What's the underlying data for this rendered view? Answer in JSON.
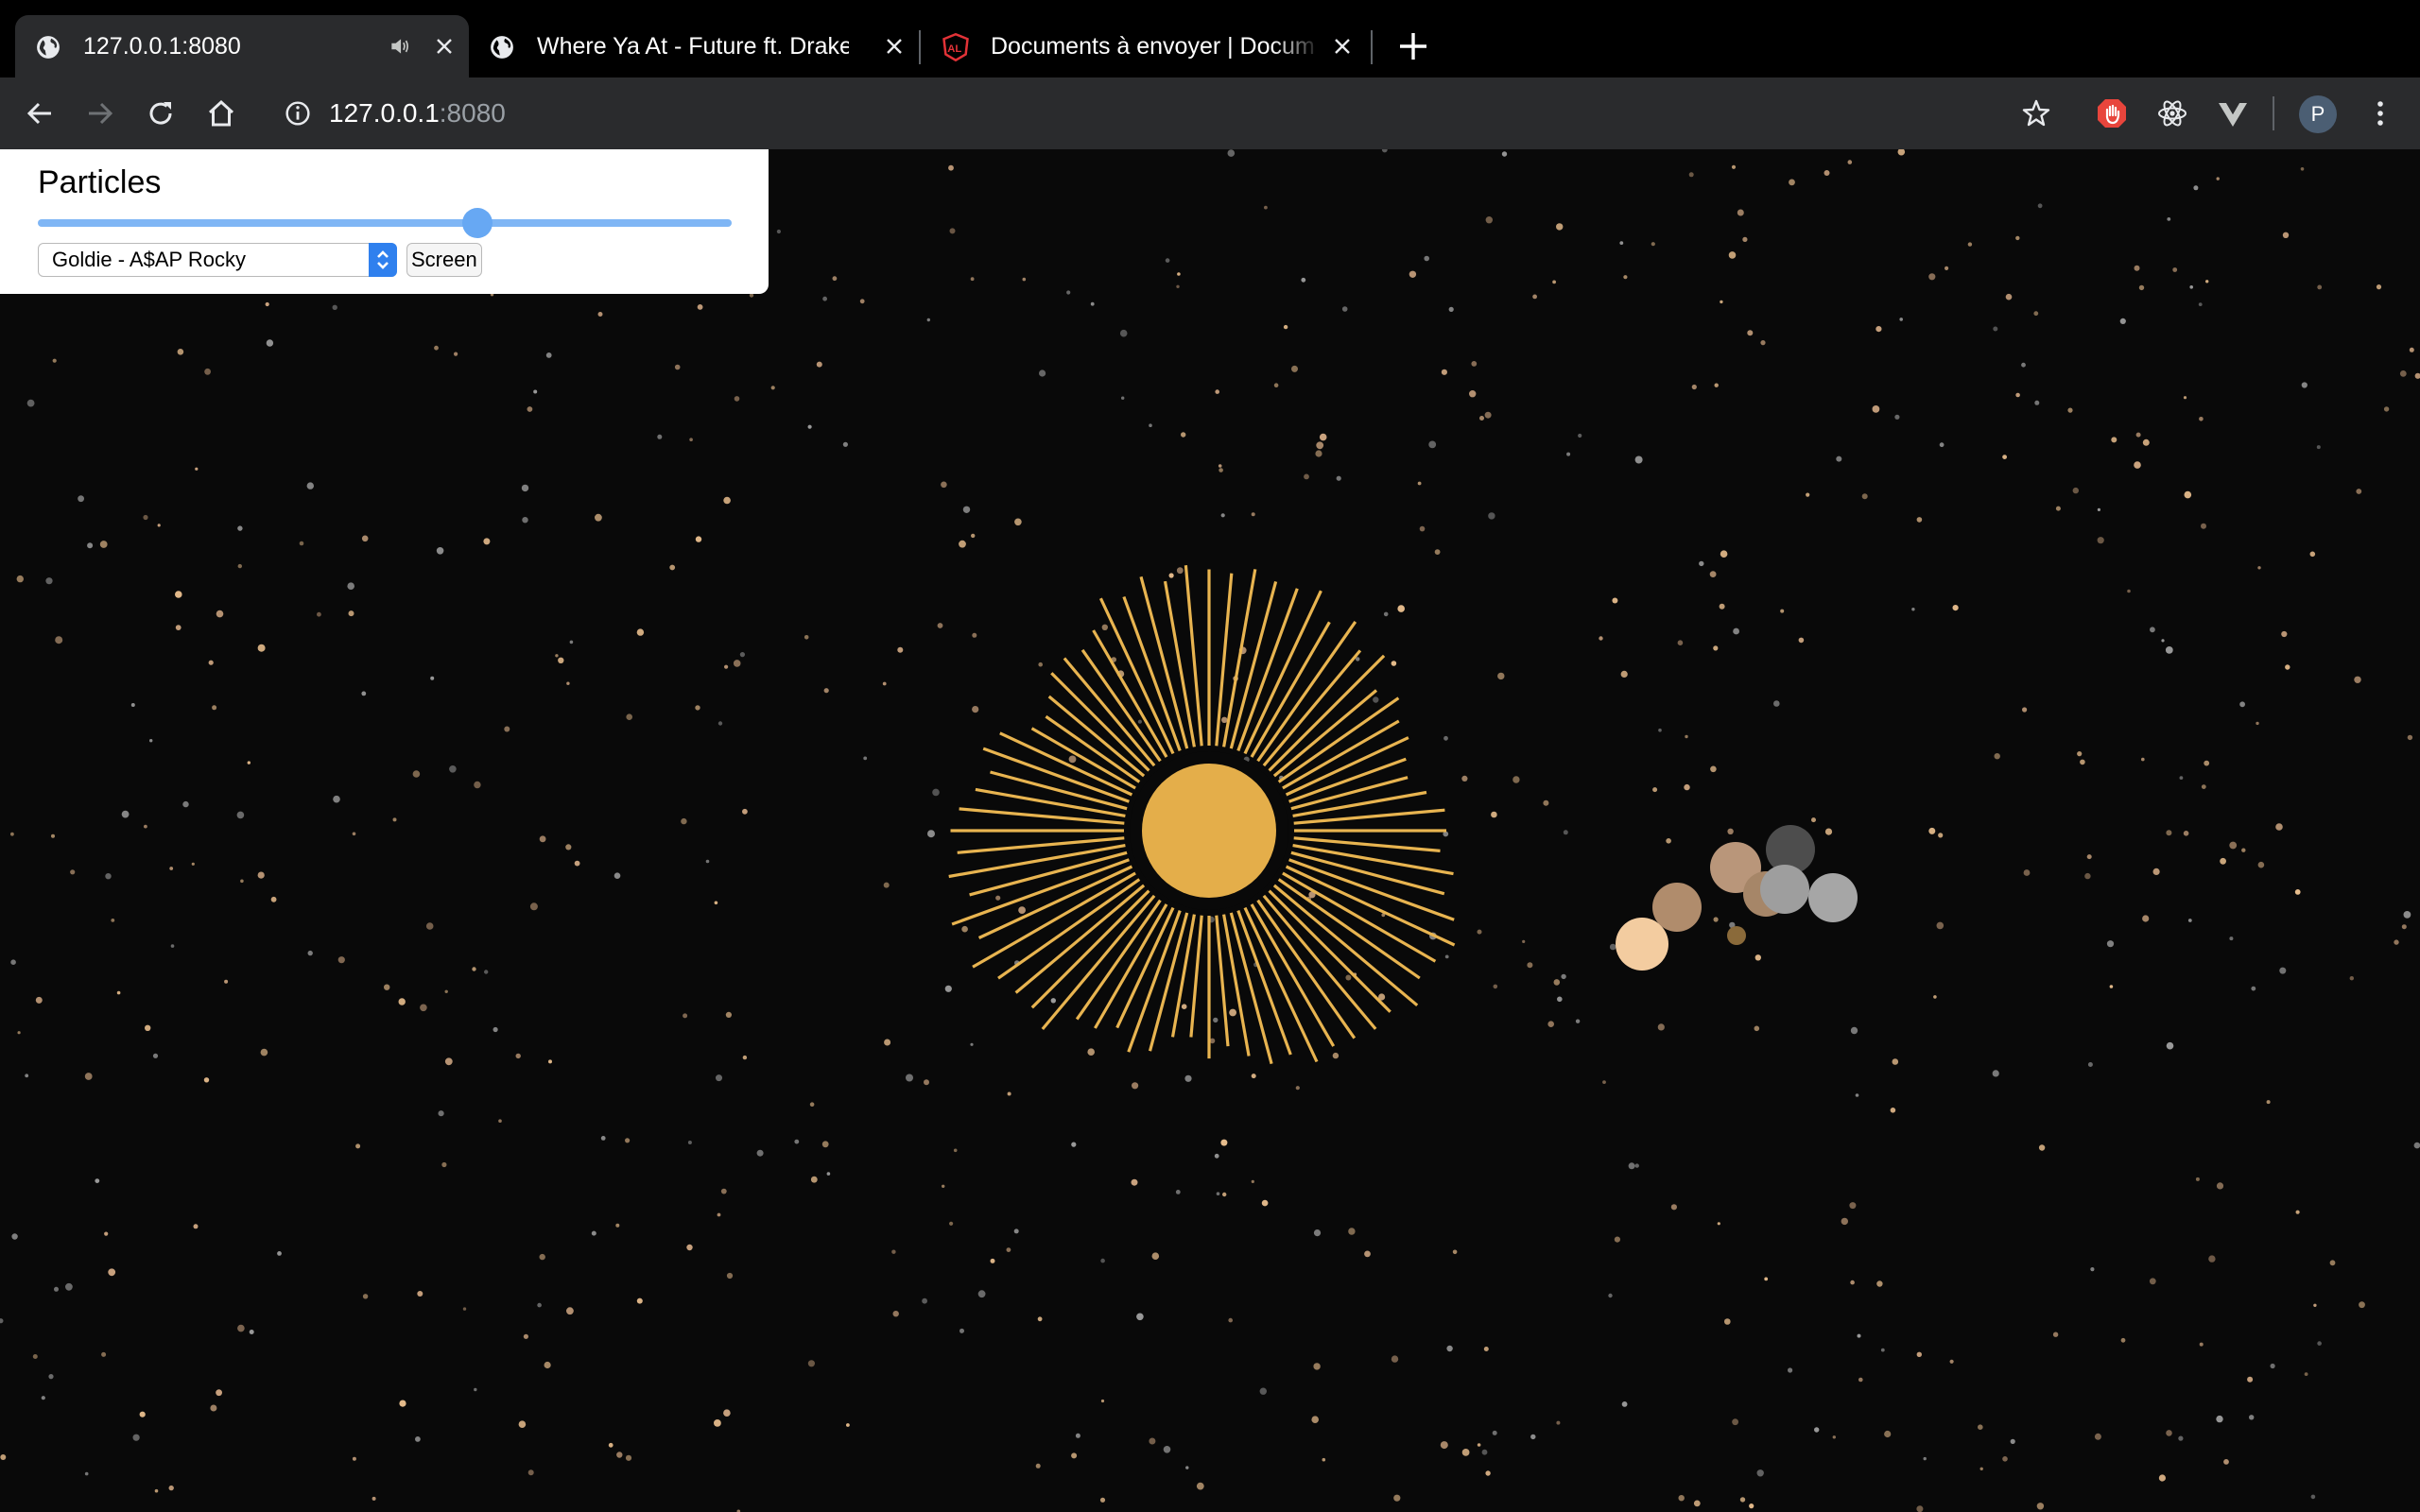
{
  "browser": {
    "tabs": [
      {
        "title": "127.0.0.1:8080",
        "active": true,
        "audio": true,
        "favicon": "globe-icon"
      },
      {
        "title": "Where Ya At - Future ft. Drake",
        "active": false,
        "favicon": "globe-icon"
      },
      {
        "title": "Documents à envoyer | Docum",
        "active": false,
        "favicon": "angular-logo-icon"
      }
    ],
    "url": {
      "host": "127.0.0.1",
      "port": ":8080"
    },
    "profile_initial": "P",
    "accent": "#e8453c"
  },
  "panel": {
    "title": "Particles",
    "slider_value": 0.64,
    "song_select": "Goldie - A$AP Rocky",
    "screen_button": "Screen"
  },
  "visualizer": {
    "sun_color": "#e4ae4a",
    "ray_color": "#e8b450",
    "particle_colors": [
      "#e6bc8c",
      "#9b9b9b",
      "#c9a27e"
    ],
    "planet_colors": [
      "#f3cca0",
      "#b08c6c",
      "#b9967a",
      "#a68668",
      "#4d4d4d",
      "#9e9e9e",
      "#a6a6a6",
      "#8a6a3a"
    ]
  }
}
